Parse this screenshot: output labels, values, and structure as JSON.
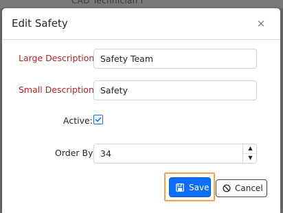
{
  "background": {
    "partial_text": "CAD Technician I"
  },
  "modal": {
    "title": "Edit Safety",
    "close_symbol": "×"
  },
  "form": {
    "large_description": {
      "label": "Large Description:*",
      "value": "Safety Team"
    },
    "small_description": {
      "label": "Small Description:*",
      "value": "Safety"
    },
    "active": {
      "label": "Active:",
      "checked": true
    },
    "order_by": {
      "label": "Order By:",
      "value": "34",
      "up_symbol": "▲",
      "down_symbol": "▼"
    }
  },
  "buttons": {
    "save_label": "Save",
    "cancel_label": "Cancel"
  },
  "icons": {
    "save": "floppy-disk-icon",
    "cancel": "ban-icon",
    "close": "close-icon",
    "check": "checkmark-icon"
  },
  "colors": {
    "required_label": "#b22222",
    "primary": "#0d6efd",
    "focus_ring": "#f0a04b"
  }
}
